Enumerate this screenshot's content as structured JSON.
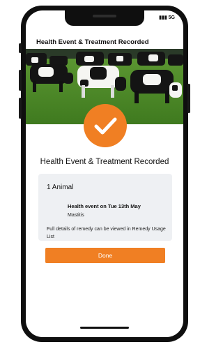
{
  "status_bar": {
    "network": "5G"
  },
  "header": {
    "title": "Health Event & Treatment Recorded"
  },
  "hero": {
    "image_desc": "cows-grazing"
  },
  "confirmation": {
    "icon": "checkmark-icon",
    "title": "Health Event & Treatment Recorded"
  },
  "summary_card": {
    "heading": "1 Animal",
    "event_title": "Health event on Tue 13th May",
    "event_condition": "Mastitis",
    "note": "Full details of remedy can be viewed in Remedy Usage List"
  },
  "actions": {
    "done_label": "Done"
  },
  "colors": {
    "accent": "#f07f23",
    "card_bg": "#eef0f3",
    "frame": "#0f0f0f"
  }
}
